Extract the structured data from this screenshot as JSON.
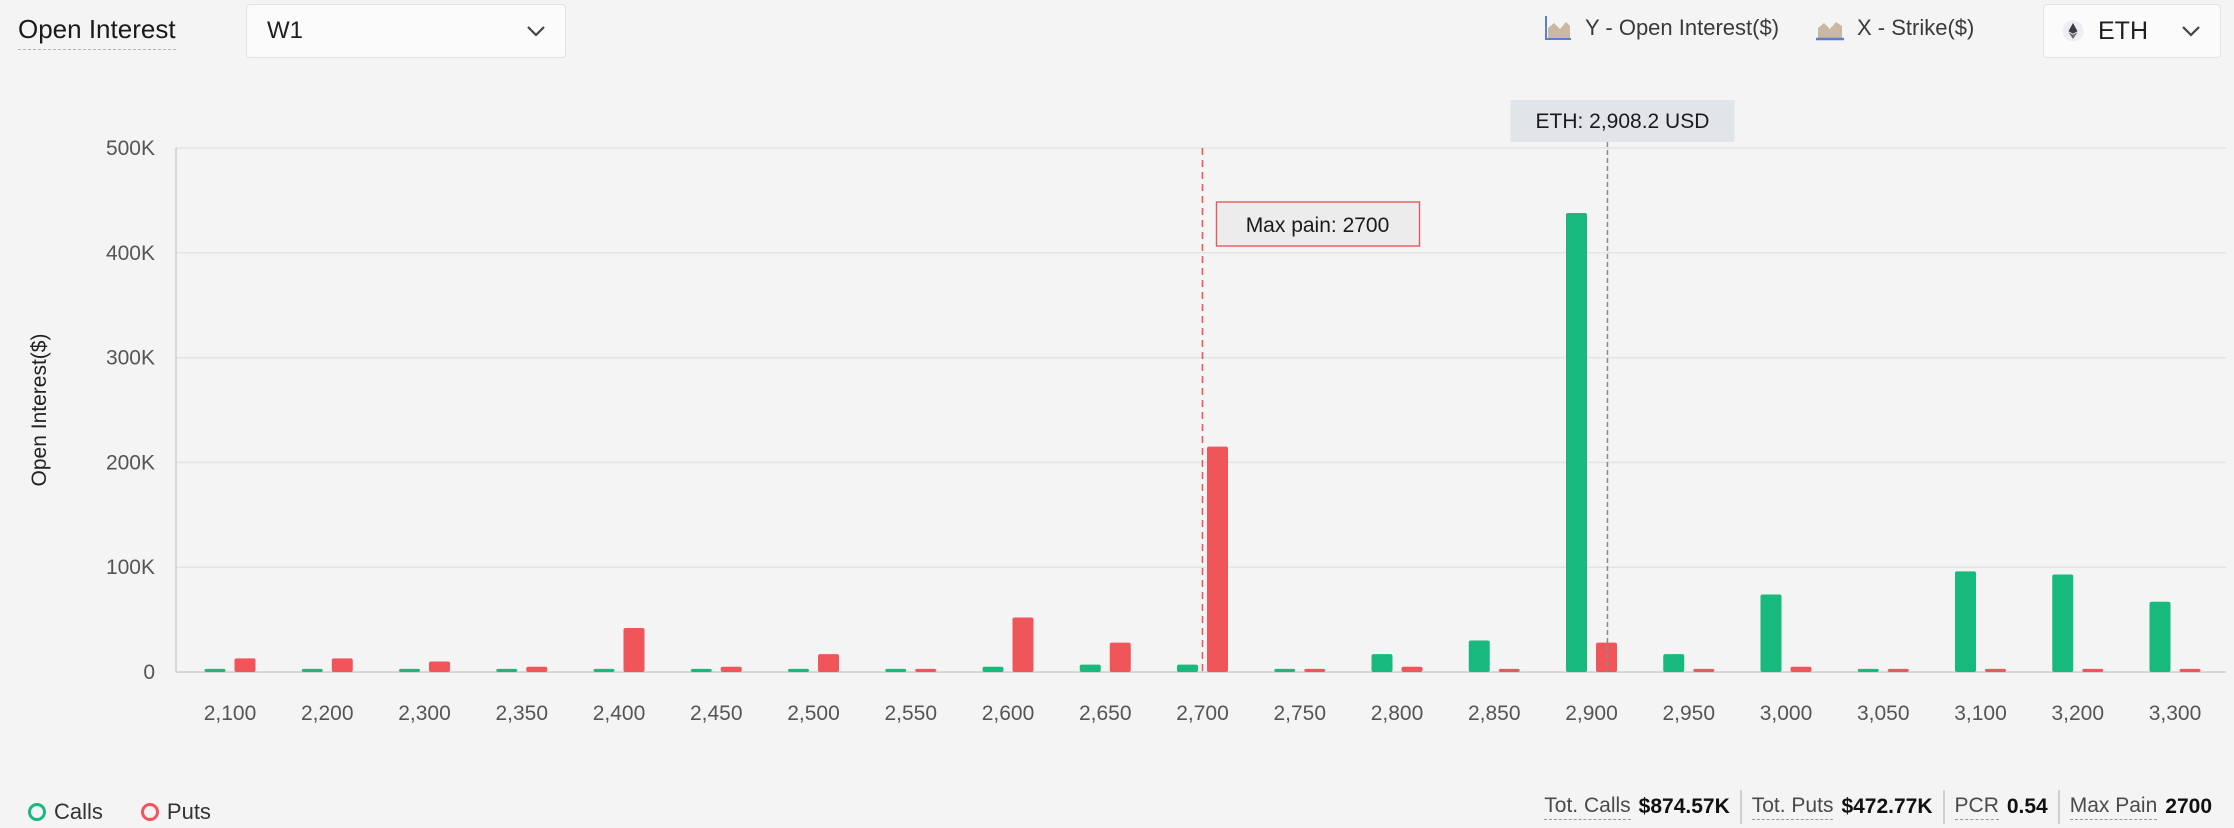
{
  "header": {
    "title": "Open Interest",
    "expiry_value": "W1",
    "y_axis_label": "Y - Open Interest($)",
    "x_axis_label": "X - Strike($)",
    "asset_value": "ETH"
  },
  "colors": {
    "calls": "#18b97c",
    "puts": "#f0555a",
    "max_pain_line": "#e8585c",
    "spot_line": "#8a8a8a"
  },
  "icons": {
    "expiry_dropdown": "chevron-down-icon",
    "asset_dropdown": "chevron-down-icon",
    "y_axis": "area-chart-icon",
    "x_axis": "area-chart-icon",
    "asset": "ethereum-icon"
  },
  "chart_data": {
    "type": "bar",
    "ylabel": "Open Interest($)",
    "ylim": [
      0,
      500000
    ],
    "yticks": [
      "0",
      "100K",
      "200K",
      "300K",
      "400K",
      "500K"
    ],
    "grid": true,
    "categories": [
      "2,100",
      "2,200",
      "2,300",
      "2,350",
      "2,400",
      "2,450",
      "2,500",
      "2,550",
      "2,600",
      "2,650",
      "2,700",
      "2,750",
      "2,800",
      "2,850",
      "2,900",
      "2,950",
      "3,000",
      "3,050",
      "3,100",
      "3,200",
      "3,300"
    ],
    "series": [
      {
        "name": "Calls",
        "values": [
          3000,
          3000,
          3000,
          3000,
          3000,
          3000,
          3000,
          3000,
          5000,
          7000,
          7000,
          3000,
          17000,
          30000,
          438000,
          17000,
          74000,
          3000,
          96000,
          93000,
          67000
        ]
      },
      {
        "name": "Puts",
        "values": [
          13000,
          13000,
          10000,
          5000,
          42000,
          5000,
          17000,
          3000,
          52000,
          28000,
          215000,
          3000,
          5000,
          3000,
          28000,
          3000,
          5000,
          3000,
          3000,
          3000,
          3000
        ]
      }
    ],
    "max_pain_label": "Max pain: 2700",
    "max_pain_index": 10,
    "spot_label": "ETH: 2,908.2 USD",
    "spot_index": 14,
    "spot_offset": 0.164
  },
  "legend": {
    "calls": "Calls",
    "puts": "Puts"
  },
  "stats": {
    "total_calls_label": "Tot. Calls",
    "total_calls_value": "$874.57K",
    "total_puts_label": "Tot. Puts",
    "total_puts_value": "$472.77K",
    "pcr_label": "PCR",
    "pcr_value": "0.54",
    "max_pain_label": "Max Pain",
    "max_pain_value": "2700"
  }
}
